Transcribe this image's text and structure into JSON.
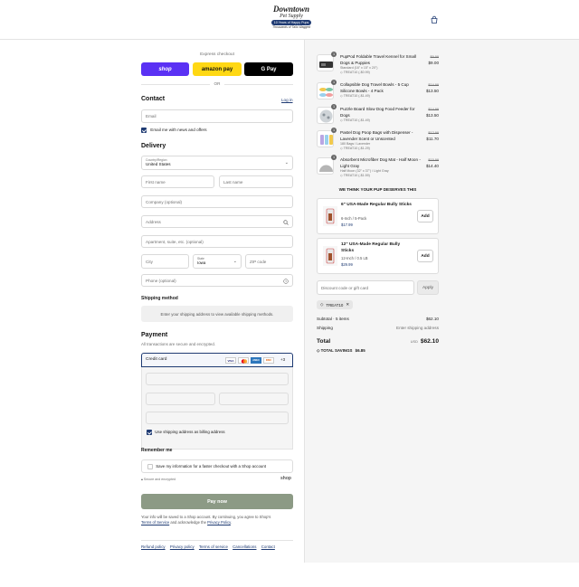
{
  "header": {
    "logo_line1": "Downtown",
    "logo_line2": "Pet Supply",
    "logo_badge": "10 Years of Happy Pups",
    "logo_tagline": "Thousands of Tails Wagged",
    "cart_icon": "shopping-bag-icon"
  },
  "express": {
    "title": "Express checkout",
    "shop_label": "shop",
    "amazon_label": "amazon pay",
    "gpay_label": "G Pay",
    "or_label": "OR",
    "colors": {
      "shop": "#5a31f4",
      "amazon": "#ffd814",
      "gpay": "#000000"
    }
  },
  "contact": {
    "title": "Contact",
    "login_link": "Log in",
    "email_placeholder": "Email",
    "news_label": "Email me with news and offers"
  },
  "delivery": {
    "title": "Delivery",
    "country_label": "Country/Region",
    "country_value": "United States",
    "first_name": "First name",
    "last_name": "Last name",
    "company": "Company (optional)",
    "address": "Address",
    "apartment": "Apartment, suite, etc. (optional)",
    "city": "City",
    "state_label": "State",
    "state_value": "Iowa",
    "zip": "ZIP code",
    "phone": "Phone (optional)"
  },
  "shipping": {
    "title": "Shipping method",
    "notice": "Enter your shipping address to view available shipping methods."
  },
  "payment": {
    "title": "Payment",
    "subtitle": "All transactions are secure and encrypted.",
    "method_label": "Credit card",
    "card_brands": [
      "VISA",
      "MC",
      "AMEX",
      "DISC"
    ],
    "more_label": "+3",
    "billing_label": "Use shipping address as billing address",
    "accent": "#1f3b73"
  },
  "remember": {
    "title": "Remember me",
    "label": "Save my information for a faster checkout with a Shop account",
    "secure_label": "Secure and encrypted",
    "shop_brand": "shop"
  },
  "pay_button": {
    "label": "Pay now",
    "color": "#8c9a85"
  },
  "legal": {
    "text_prefix": "Your info will be saved to a Shop account. By continuing, you agree to Shop's",
    "terms": "Terms of Service",
    "middle": "and acknowledge the",
    "privacy": "Privacy Policy"
  },
  "footer_links": [
    "Refund policy",
    "Privacy policy",
    "Terms of service",
    "Cancellations",
    "Contact"
  ],
  "cart": {
    "items": [
      {
        "qty": "1",
        "name": "PupPod Foldable Travel Kennel for Small Dogs & Puppies",
        "variant": "Standard (16\" x 15\" x 20\")",
        "tag": "TREAT10 (-$0.99)",
        "old_price": "$9.99",
        "price": "$9.00"
      },
      {
        "qty": "1",
        "name": "Collapsible Dog Travel Bowls - 5 Cup Silicone Bowls - 4 Pack",
        "variant": "",
        "tag": "TREAT10 (-$1.49)",
        "old_price": "$14.99",
        "price": "$13.50"
      },
      {
        "qty": "1",
        "name": "Puzzle Board Slow Dog Food Feeder for Dogs",
        "variant": "",
        "tag": "TREAT10 (-$1.49)",
        "old_price": "$14.99",
        "price": "$13.50"
      },
      {
        "qty": "1",
        "name": "Pastel Dog Poop Bags with Dispenser - Lavender Scent or Unscented",
        "variant": "180 Bags / Lavender",
        "tag": "TREAT10 (-$1.29)",
        "old_price": "$12.99",
        "price": "$11.70"
      },
      {
        "qty": "1",
        "name": "Absorbent Microfiber Dog Mat - Half Moon - Light Gray",
        "variant": "Half Moon (32\" x 37\") / Light Gray",
        "tag": "TREAT10 (-$1.59)",
        "old_price": "$15.99",
        "price": "$14.40"
      }
    ],
    "upsell_title": "WE THINK YOUR PUP DESERVES THIS",
    "upsells": [
      {
        "name": "6\" USA-Made Regular Bully Sticks",
        "variant": "6-Inch / 5-Pack",
        "price": "$17.99",
        "add": "Add"
      },
      {
        "name": "12\" USA-Made Regular Bully Sticks",
        "variant": "12-Inch / 0.5 LB",
        "price": "$29.99",
        "add": "Add"
      }
    ],
    "discount_placeholder": "Discount code or gift card",
    "apply_label": "Apply",
    "code_chip": "TREAT10",
    "subtotal_label": "Subtotal · 5 items",
    "subtotal_value": "$62.10",
    "shipping_label": "Shipping",
    "shipping_value": "Enter shipping address",
    "total_label": "Total",
    "currency": "USD",
    "total_value": "$62.10",
    "savings_label": "TOTAL SAVINGS",
    "savings_value": "$6.85"
  }
}
